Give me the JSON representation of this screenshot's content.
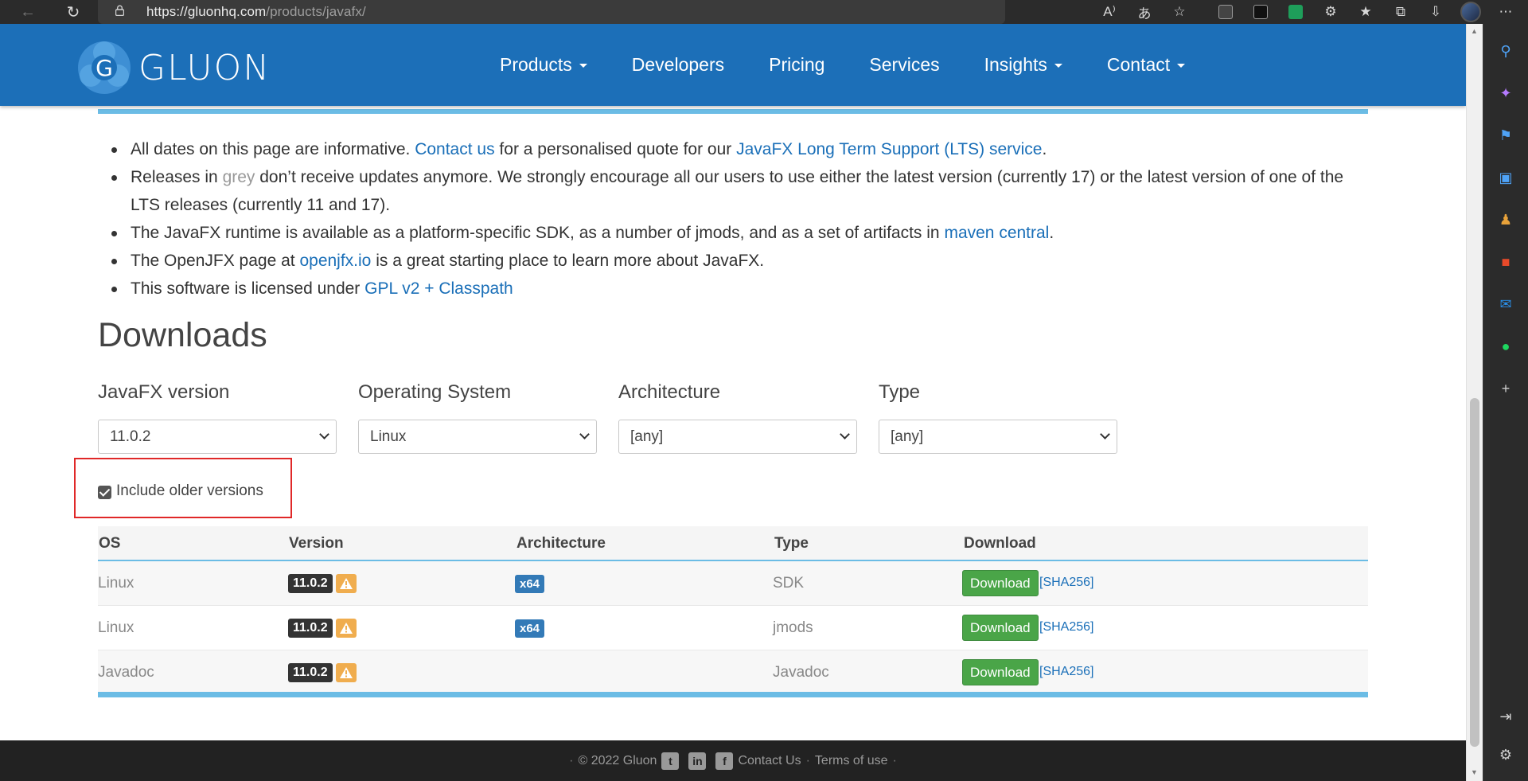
{
  "browser": {
    "url_host": "https://gluonhq.com",
    "url_path": "/products/javafx/"
  },
  "nav": {
    "logo_text": "GLUON",
    "items": [
      {
        "label": "Products",
        "dropdown": true
      },
      {
        "label": "Developers",
        "dropdown": false
      },
      {
        "label": "Pricing",
        "dropdown": false
      },
      {
        "label": "Services",
        "dropdown": false
      },
      {
        "label": "Insights",
        "dropdown": true
      },
      {
        "label": "Contact",
        "dropdown": true
      }
    ]
  },
  "notes": {
    "b1_pre": "All dates on this page are informative. ",
    "b1_link1": "Contact us",
    "b1_mid": " for a personalised quote for our ",
    "b1_link2": "JavaFX Long Term Support (LTS) service",
    "b1_post": ".",
    "b2_pre": "Releases in ",
    "b2_grey": "grey",
    "b2_post": " don’t receive updates anymore. We strongly encourage all our users to use either the latest version (currently 17) or the latest version of one of the LTS releases (currently 11 and 17).",
    "b3_pre": "The JavaFX runtime is available as a platform-specific SDK, as a number of jmods, and as a set of artifacts in ",
    "b3_link": "maven central",
    "b3_post": ".",
    "b4_pre": "The OpenJFX page at ",
    "b4_link": "openjfx.io",
    "b4_post": " is a great starting place to learn more about JavaFX.",
    "b5_pre": "This software is licensed under ",
    "b5_link": "GPL v2 + Classpath"
  },
  "downloads": {
    "title": "Downloads",
    "filters": {
      "version": {
        "label": "JavaFX version",
        "value": "11.0.2"
      },
      "os": {
        "label": "Operating System",
        "value": "Linux"
      },
      "arch": {
        "label": "Architecture",
        "value": "[any]"
      },
      "type": {
        "label": "Type",
        "value": "[any]"
      }
    },
    "include_older": {
      "label": "Include older versions",
      "checked": true
    },
    "table": {
      "headers": {
        "os": "OS",
        "version": "Version",
        "architecture": "Architecture",
        "type": "Type",
        "download": "Download"
      },
      "rows": [
        {
          "os": "Linux",
          "version": "11.0.2",
          "arch": "x64",
          "type": "SDK",
          "download": "Download",
          "sha": "[SHA256]"
        },
        {
          "os": "Linux",
          "version": "11.0.2",
          "arch": "x64",
          "type": "jmods",
          "download": "Download",
          "sha": "[SHA256]"
        },
        {
          "os": "Javadoc",
          "version": "11.0.2",
          "arch": "",
          "type": "Javadoc",
          "download": "Download",
          "sha": "[SHA256]"
        }
      ]
    }
  },
  "footer": {
    "copyright": "© 2022 Gluon",
    "contact": "Contact Us",
    "terms": "Terms of use",
    "social_icons": [
      "twitter-icon",
      "linkedin-icon",
      "facebook-icon"
    ]
  },
  "colors": {
    "navbar": "#1c6fb8",
    "accent_line": "#6bbce5",
    "link": "#1a6fb8",
    "download_button": "#4aa548",
    "highlight": "#e02828"
  }
}
